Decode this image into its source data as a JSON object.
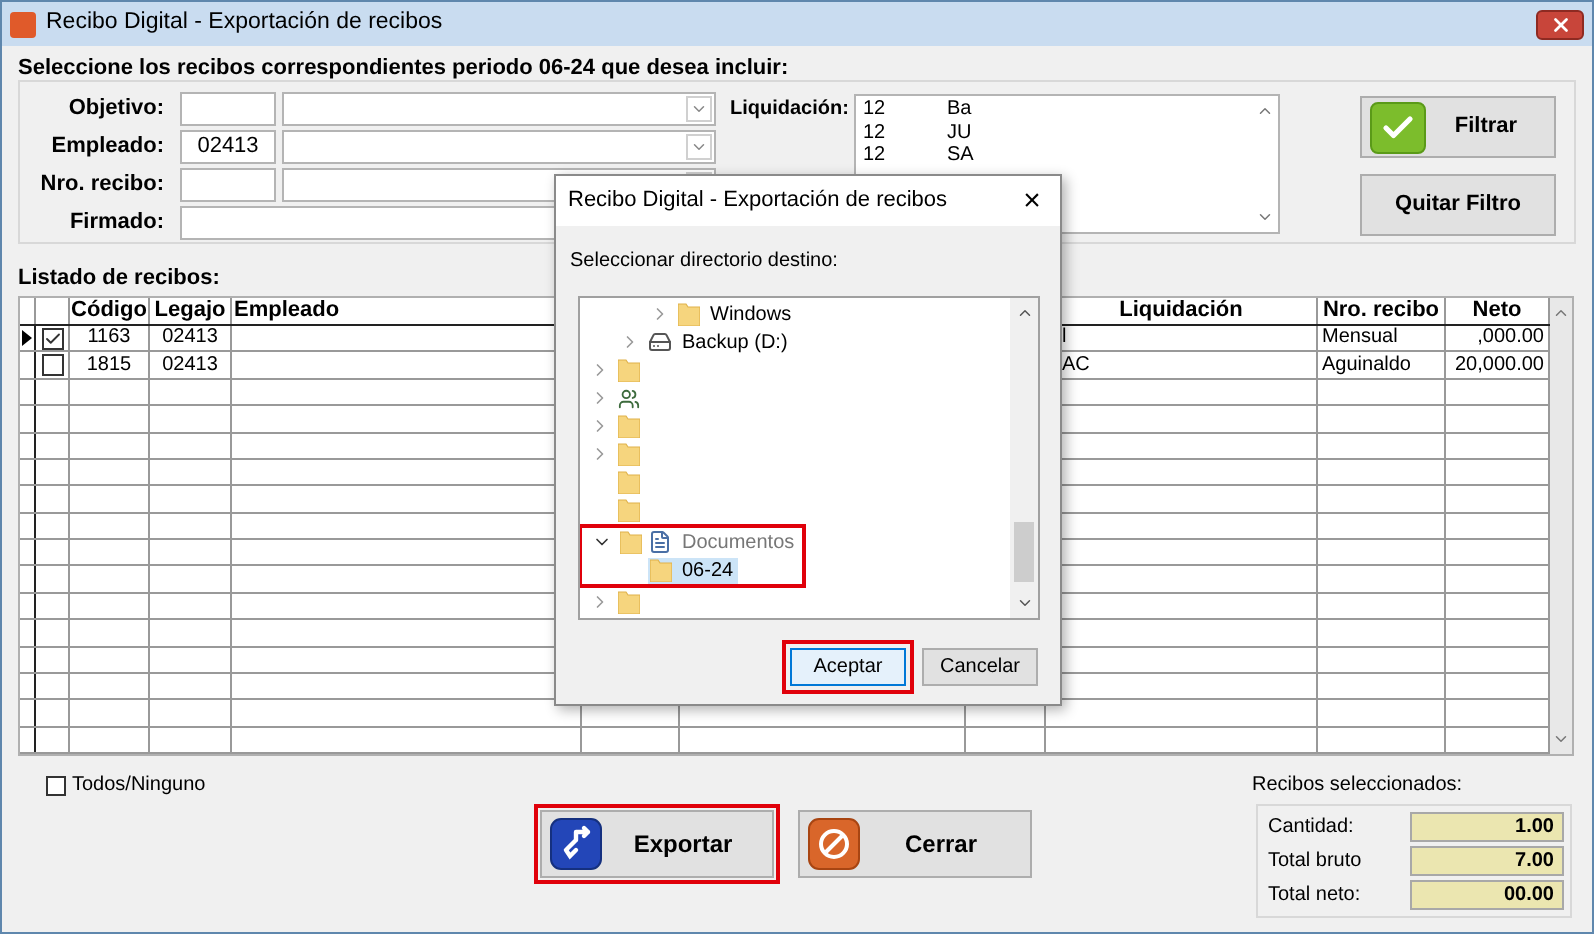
{
  "window": {
    "title": "Recibo Digital - Exportación de recibos"
  },
  "heading": "Seleccione los recibos correspondientes periodo 06-24 que desea incluir:",
  "filters": [
    {
      "label": "Objetivo:",
      "kind": "code-combo"
    },
    {
      "label": "Empleado:",
      "kind": "code-combo",
      "code": "02413"
    },
    {
      "label": "Nro. recibo:",
      "kind": "code-combo"
    },
    {
      "label": "Firmado:",
      "kind": "text"
    }
  ],
  "liquidacion": {
    "label": "Liquidación:",
    "items": [
      [
        "12",
        "Ba"
      ],
      [
        "12",
        "JU"
      ],
      [
        "12",
        "SA"
      ]
    ]
  },
  "filter_buttons": [
    {
      "label": "Filtrar",
      "kind": "filter"
    },
    {
      "label": "Quitar Filtro",
      "kind": "clear"
    }
  ],
  "list_title": "Listado de recibos:",
  "table": {
    "columns": [
      "Código",
      "Legajo",
      "Empleado",
      null,
      null,
      null,
      "Liquidación",
      "Nro. recibo",
      "Neto"
    ],
    "rows": [
      {
        "current": true,
        "checked": true,
        "cells": [
          "1163",
          "02413",
          null,
          null,
          null,
          null,
          "l",
          "Mensual",
          ",000.00"
        ]
      },
      {
        "current": false,
        "checked": false,
        "cells": [
          "1815",
          "02413",
          null,
          null,
          null,
          null,
          "AC",
          "Aguinaldo",
          "20,000.00"
        ]
      }
    ]
  },
  "select_all": {
    "label": "Todos/Ninguno",
    "checked": false
  },
  "actions": [
    {
      "label": "Exportar",
      "kind": "export",
      "highlighted": true
    },
    {
      "label": "Cerrar",
      "kind": "close",
      "highlighted": false
    }
  ],
  "summary": {
    "title": "Recibos seleccionados:",
    "fields": [
      {
        "label": "Cantidad:",
        "value": "1.00"
      },
      {
        "label": "Total bruto",
        "value": "7.00"
      },
      {
        "label": "Total neto:",
        "value": "00.00"
      }
    ]
  },
  "dialog": {
    "title": "Recibo Digital - Exportación de recibos",
    "close": "×",
    "prompt": "Seleccionar directorio destino:",
    "tree": [
      {
        "children": [
          {
            "children": [
              {
                "kind": "folder",
                "label": "Windows",
                "expandable": true,
                "expanded": false,
                "selected": false,
                "highlighted": false
              }
            ]
          },
          {
            "kind": "drive",
            "label": "Backup (D:)",
            "expandable": true,
            "expanded": false,
            "selected": false,
            "highlighted": false
          }
        ]
      },
      {
        "kind": "folder",
        "expandable": true,
        "expanded": false,
        "selected": false,
        "highlighted": false
      },
      {
        "kind": "people",
        "expandable": true,
        "expanded": false,
        "selected": false,
        "highlighted": false
      },
      {
        "kind": "folder",
        "expandable": true,
        "expanded": false,
        "selected": false,
        "highlighted": false
      },
      {
        "kind": "folder",
        "expandable": true,
        "expanded": false,
        "selected": false,
        "highlighted": false
      },
      {
        "kind": "folder",
        "expandable": false,
        "selected": false,
        "highlighted": false
      },
      {
        "kind": "folder",
        "expandable": false,
        "selected": false,
        "highlighted": false
      },
      {
        "kind": "library",
        "label": "Documentos",
        "expandable": true,
        "expanded": true,
        "selected": false,
        "highlighted": true,
        "children": [
          {
            "kind": "folder",
            "label": "06-24",
            "expandable": false,
            "selected": true,
            "highlighted": false
          }
        ]
      },
      {
        "kind": "folder",
        "expandable": true,
        "expanded": false,
        "selected": false,
        "highlighted": false
      }
    ],
    "buttons": [
      {
        "label": "Aceptar",
        "highlighted": true,
        "default": true
      },
      {
        "label": "Cancelar",
        "highlighted": false,
        "default": false
      }
    ]
  }
}
